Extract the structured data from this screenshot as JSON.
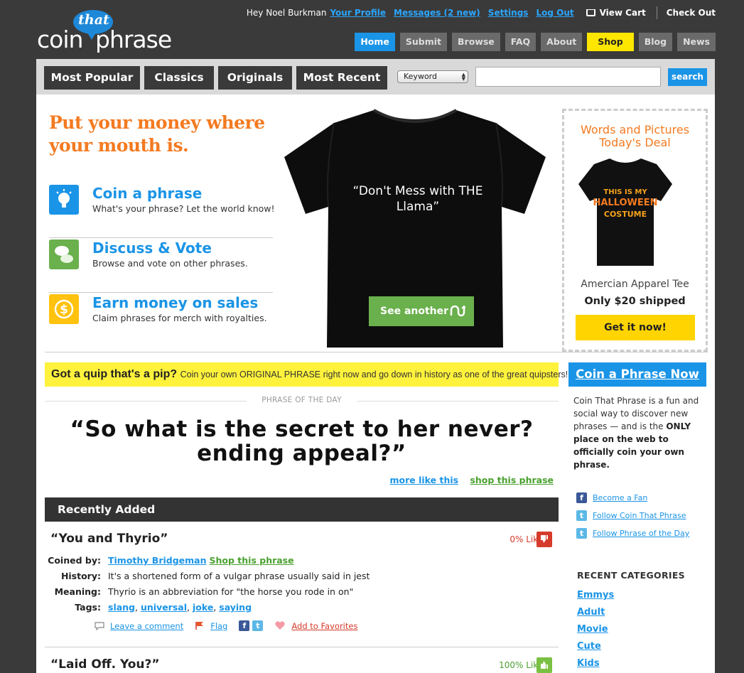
{
  "logo": {
    "small": "that",
    "word1": "coin",
    "word2": "phrase"
  },
  "userbar": {
    "greeting": "Hey Noel Burkman",
    "links": [
      "Your Profile",
      "Messages (2 new)",
      "Settings",
      "Log Out"
    ],
    "cart": "View Cart",
    "checkout": "Check Out"
  },
  "nav": [
    "Home",
    "Submit",
    "Browse",
    "FAQ",
    "About",
    "Shop",
    "Blog",
    "News"
  ],
  "categories": [
    "Most Popular",
    "Classics",
    "Originals",
    "Most Recent"
  ],
  "search": {
    "select_value": "Keyword",
    "button": "search",
    "placeholder": ""
  },
  "hero": {
    "headline": "Put your money where your mouth is.",
    "features": [
      {
        "title": "Coin a phrase",
        "desc": "What's your phrase? Let the world know!",
        "color": "#1a94e6"
      },
      {
        "title": "Discuss & Vote",
        "desc": "Browse and vote on other phrases.",
        "color": "#6ab04c"
      },
      {
        "title": "Earn money on sales",
        "desc": "Claim phrases for merch with royalties.",
        "color": "#ffc20e"
      }
    ],
    "shirt_text": "“Don't Mess with THE Llama”",
    "see_another": "See another"
  },
  "deal": {
    "title": "Words and Pictures Today's Deal",
    "shirt_print": [
      "THIS IS MY",
      "HALLOWEEN",
      "COSTUME"
    ],
    "brand": "Amercian Apparel Tee",
    "price": "Only $20 shipped",
    "button": "Get it now!"
  },
  "quip": {
    "bold": "Got a quip that's a pip?",
    "text": "Coin your own ORIGINAL PHRASE right now and go down in history as one of the great quipsters!"
  },
  "potd": {
    "label": "PHRASE OF THE DAY",
    "phrase": "“So what is the secret to her never?ending appeal?”",
    "more": "more like this",
    "shop": "shop this phrase"
  },
  "recent": {
    "title": "Recently Added",
    "entries": [
      {
        "phrase": "“You and Thyrio”",
        "like": "0% Like it",
        "labels": {
          "coined": "Coined by:",
          "history": "History:",
          "meaning": "Meaning:",
          "tags": "Tags:"
        },
        "coined_by": "Timothy Bridgeman",
        "shop": "Shop this phrase",
        "history": "It's a shortened form of a vulgar phrase usually said in jest",
        "meaning": "Thyrio is an abbreviation for \"the horse you rode in on\"",
        "tags": [
          "slang",
          "universal",
          "joke",
          "saying"
        ],
        "actions": {
          "comment": "Leave a comment",
          "flag": "Flag",
          "favorite": "Add to Favorites"
        }
      },
      {
        "phrase": "“Laid Off. You?”",
        "like": "100% Like it"
      }
    ]
  },
  "sidebar": {
    "cta": "Coin a Phrase Now",
    "about_pre": "Coin That Phrase is a fun and social way to discover new phrases — and is the ",
    "about_bold": "ONLY place on the web to officially coin your own phrase.",
    "social": [
      "Become a Fan",
      "Follow Coin That Phrase",
      "Follow Phrase of the Day"
    ],
    "categories_title": "RECENT CATEGORIES",
    "categories": [
      "Emmys",
      "Adult",
      "Movie",
      "Cute",
      "Kids"
    ]
  }
}
